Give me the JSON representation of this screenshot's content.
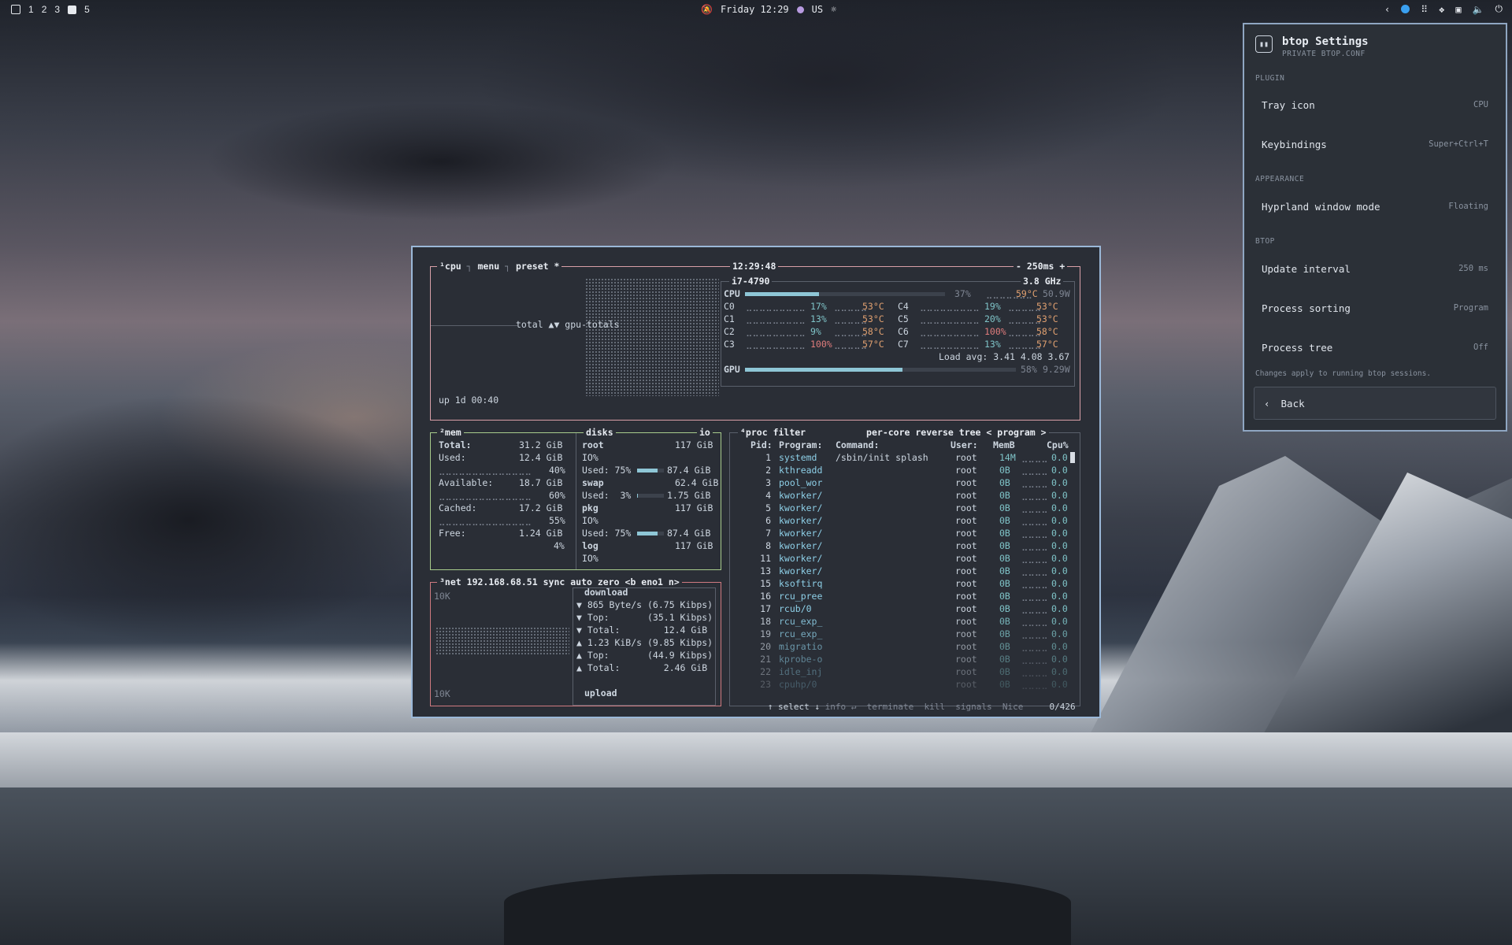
{
  "topbar": {
    "workspaces": [
      "1",
      "2",
      "3",
      "5"
    ],
    "clock": "Friday 12:29",
    "layout": "US"
  },
  "btop": {
    "cpu": {
      "title": "¹cpu",
      "menu": "menu",
      "preset": "preset *",
      "time": "12:29:48",
      "interval": "- 250ms +",
      "graph_label": "total ▲▼ gpu-totals",
      "uptime": "up 1d 00:40",
      "model": "i7-4790",
      "freq": "3.8 GHz",
      "cpu_row": {
        "label": "CPU",
        "pct": "37%",
        "temp": "59°C",
        "power": "50.9W",
        "fill": 0.37
      },
      "cores": [
        {
          "name": "C0",
          "pct": "17%",
          "temp": "53°C"
        },
        {
          "name": "C1",
          "pct": "13%",
          "temp": "53°C"
        },
        {
          "name": "C2",
          "pct": "9%",
          "temp": "58°C"
        },
        {
          "name": "C3",
          "pct": "100%",
          "temp": "57°C"
        },
        {
          "name": "C4",
          "pct": "19%",
          "temp": "53°C"
        },
        {
          "name": "C5",
          "pct": "20%",
          "temp": "53°C"
        },
        {
          "name": "C6",
          "pct": "100%",
          "temp": "58°C"
        },
        {
          "name": "C7",
          "pct": "13%",
          "temp": "57°C"
        }
      ],
      "load": "Load avg: 3.41 4.08 3.67",
      "gpu_row": {
        "label": "GPU",
        "pct": "58%",
        "power": "9.29W",
        "fill": 0.58
      }
    },
    "mem": {
      "title": "²mem",
      "disks_title": "disks",
      "io": "io",
      "total": {
        "label": "Total:",
        "val": "31.2 GiB"
      },
      "used": {
        "label": "Used:",
        "val": "12.4 GiB",
        "pct": "40%"
      },
      "available": {
        "label": "Available:",
        "val": "18.7 GiB",
        "pct": "60%"
      },
      "cached": {
        "label": "Cached:",
        "val": "17.2 GiB",
        "pct": "55%"
      },
      "free": {
        "label": "Free:",
        "val": "1.24 GiB",
        "pct": "4%"
      },
      "disks": [
        {
          "name": "root",
          "size": "117 GiB",
          "io": "IO%",
          "used": "Used: 75%",
          "usedval": "87.4 GiB",
          "fill": 0.75
        },
        {
          "name": "swap",
          "size": "62.4 GiB",
          "io": "",
          "used": "Used:  3%",
          "usedval": "1.75 GiB",
          "fill": 0.03
        },
        {
          "name": "pkg",
          "size": "117 GiB",
          "io": "IO%",
          "used": "Used: 75%",
          "usedval": "87.4 GiB",
          "fill": 0.75
        },
        {
          "name": "log",
          "size": "117 GiB",
          "io": "IO%",
          "used": "",
          "usedval": "",
          "fill": 0
        }
      ]
    },
    "net": {
      "title": "³net",
      "ip": "192.168.68.51",
      "sync": "sync",
      "auto": "auto",
      "zero": "zero",
      "iface": "<b eno1 n>",
      "scale_top": "10K",
      "scale_bottom": "10K",
      "download": "download",
      "upload": "upload",
      "lines": [
        "▼ 865 Byte/s (6.75 Kibps)",
        "▼ Top:       (35.1 Kibps)",
        "▼ Total:        12.4 GiB",
        "▲ 1.23 KiB/s (9.85 Kibps)",
        "▲ Top:       (44.9 Kibps)",
        "▲ Total:        2.46 GiB"
      ]
    },
    "proc": {
      "title": "⁴proc",
      "filter": "filter",
      "percore": "per-core",
      "reverse": "reverse",
      "tree": "tree",
      "program": "< program >",
      "headers": {
        "pid": "Pid:",
        "program": "Program:",
        "command": "Command:",
        "user": "User:",
        "mem": "MemB",
        "cpu": "Cpu%"
      },
      "rows": [
        {
          "pid": "1",
          "program": "systemd",
          "command": "/sbin/init splash",
          "user": "root",
          "mem": "14M",
          "cpu": "0.0"
        },
        {
          "pid": "2",
          "program": "kthreadd",
          "command": "",
          "user": "root",
          "mem": "0B",
          "cpu": "0.0"
        },
        {
          "pid": "3",
          "program": "pool_wor",
          "command": "",
          "user": "root",
          "mem": "0B",
          "cpu": "0.0"
        },
        {
          "pid": "4",
          "program": "kworker/",
          "command": "",
          "user": "root",
          "mem": "0B",
          "cpu": "0.0"
        },
        {
          "pid": "5",
          "program": "kworker/",
          "command": "",
          "user": "root",
          "mem": "0B",
          "cpu": "0.0"
        },
        {
          "pid": "6",
          "program": "kworker/",
          "command": "",
          "user": "root",
          "mem": "0B",
          "cpu": "0.0"
        },
        {
          "pid": "7",
          "program": "kworker/",
          "command": "",
          "user": "root",
          "mem": "0B",
          "cpu": "0.0"
        },
        {
          "pid": "8",
          "program": "kworker/",
          "command": "",
          "user": "root",
          "mem": "0B",
          "cpu": "0.0"
        },
        {
          "pid": "11",
          "program": "kworker/",
          "command": "",
          "user": "root",
          "mem": "0B",
          "cpu": "0.0"
        },
        {
          "pid": "13",
          "program": "kworker/",
          "command": "",
          "user": "root",
          "mem": "0B",
          "cpu": "0.0"
        },
        {
          "pid": "15",
          "program": "ksoftirq",
          "command": "",
          "user": "root",
          "mem": "0B",
          "cpu": "0.0"
        },
        {
          "pid": "16",
          "program": "rcu_pree",
          "command": "",
          "user": "root",
          "mem": "0B",
          "cpu": "0.0"
        },
        {
          "pid": "17",
          "program": "rcub/0",
          "command": "",
          "user": "root",
          "mem": "0B",
          "cpu": "0.0"
        },
        {
          "pid": "18",
          "program": "rcu_exp_",
          "command": "",
          "user": "root",
          "mem": "0B",
          "cpu": "0.0"
        },
        {
          "pid": "19",
          "program": "rcu_exp_",
          "command": "",
          "user": "root",
          "mem": "0B",
          "cpu": "0.0"
        },
        {
          "pid": "20",
          "program": "migratio",
          "command": "",
          "user": "root",
          "mem": "0B",
          "cpu": "0.0"
        },
        {
          "pid": "21",
          "program": "kprobe-o",
          "command": "",
          "user": "root",
          "mem": "0B",
          "cpu": "0.0"
        },
        {
          "pid": "22",
          "program": "idle_inj",
          "command": "",
          "user": "root",
          "mem": "0B",
          "cpu": "0.0"
        },
        {
          "pid": "23",
          "program": "cpuhp/0",
          "command": "",
          "user": "root",
          "mem": "0B",
          "cpu": "0.0"
        }
      ],
      "footer": {
        "select": "↑ select ↓",
        "info": "info ↵",
        "terminate": "terminate",
        "kill": "kill",
        "signals": "signals",
        "nice": "Nice",
        "count": "0/426"
      }
    }
  },
  "settings": {
    "title": "btop Settings",
    "subtitle": "PRIVATE BTOP.CONF",
    "sections": {
      "plugin": "PLUGIN",
      "appearance": "APPEARANCE",
      "btop": "BTOP"
    },
    "tray_icon": {
      "label": "Tray icon",
      "value": "CPU"
    },
    "keybindings": {
      "label": "Keybindings",
      "value": "Super+Ctrl+T"
    },
    "window_mode": {
      "label": "Hyprland window mode",
      "value": "Floating"
    },
    "update_interval": {
      "label": "Update interval",
      "value": "250 ms"
    },
    "process_sorting": {
      "label": "Process sorting",
      "value": "Program"
    },
    "process_tree": {
      "label": "Process tree",
      "value": "Off"
    },
    "note": "Changes apply to running btop sessions.",
    "back": "Back"
  }
}
